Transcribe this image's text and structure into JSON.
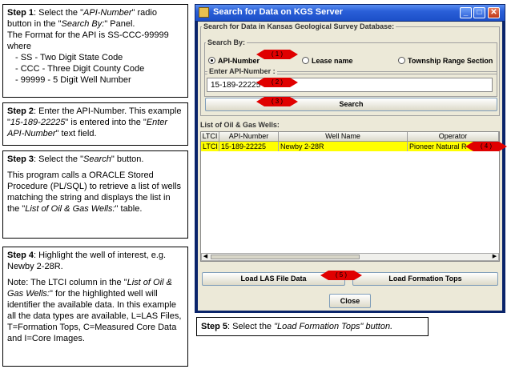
{
  "steps": {
    "s1": {
      "label": "Step 1",
      "line1_a": ": Select the \"",
      "line1_b": "API-Number",
      "line1_c": "\" radio button in the \"",
      "line1_d": "Search By:",
      "line1_e": "\" Panel.",
      "line2": "The Format for the API is SS-CCC-99999 where",
      "items": [
        "- SS -  Two Digit State Code",
        "- CCC -  Three Digit County Code",
        "- 99999 - 5 Digit Well Number"
      ]
    },
    "s2": {
      "label": "Step 2",
      "a": ": Enter the API-Number. This example \"",
      "b": "15-189-22225",
      "c": "\" is entered into the \"",
      "d": "Enter API-Number",
      "e": "\" text field."
    },
    "s3": {
      "label": "Step 3",
      "a": ": Select the \"",
      "b": "Search",
      "c": "\" button.",
      "p2a": "This program calls a ORACLE Stored Procedure (PL/SQL) to retrieve a list of wells matching the string and displays the list in the \"",
      "p2b": "List of Oil & Gas Wells:",
      "p2c": "\" table."
    },
    "s4": {
      "label": "Step 4",
      "a": ": Highlight the well of interest, e.g. Newby 2-28R.",
      "p2a": "Note: The LTCI column in the \"",
      "p2b": "List of Oil & Gas Wells:",
      "p2c": "\" for the highlighted well will identifier the available data. In this example all the data types are available, L=LAS Files, T=Formation Tops, C=Measured Core Data and I=Core Images."
    },
    "s5": {
      "label": "Step 5",
      "a": ": Select the ",
      "b": "\"Load Formation Tops\" button."
    }
  },
  "window": {
    "title": "Search for Data on KGS Server",
    "outer_group": "Search for Data in Kansas Geological Survey Database:",
    "search_by": "Search By:",
    "radio_api": "API-Number",
    "radio_lease": "Lease name",
    "radio_township": "Township Range Section",
    "api_group": "Enter API-Number :",
    "api_value": "15-189-22225",
    "search_button": "Search",
    "list_label": "List of Oil & Gas Wells:",
    "columns": [
      "LTCI",
      "API-Number",
      "Well Name",
      "Operator"
    ],
    "row": [
      "LTCI",
      "15-189-22225",
      "Newby 2-28R",
      "Pioneer Natural R"
    ],
    "load_las": "Load LAS File Data",
    "load_tops": "Load Formation Tops",
    "close": "Close",
    "minimize_glyph": "_",
    "maximize_glyph": "□",
    "close_glyph": "✕"
  },
  "callouts": [
    "( 1 )",
    "( 2 )",
    "( 3 )",
    "( 4 )",
    "( 5 )"
  ],
  "colors": {
    "callout": "#e00000",
    "highlight_row": "#ffff00",
    "titlebar": "#2a5fd8"
  }
}
